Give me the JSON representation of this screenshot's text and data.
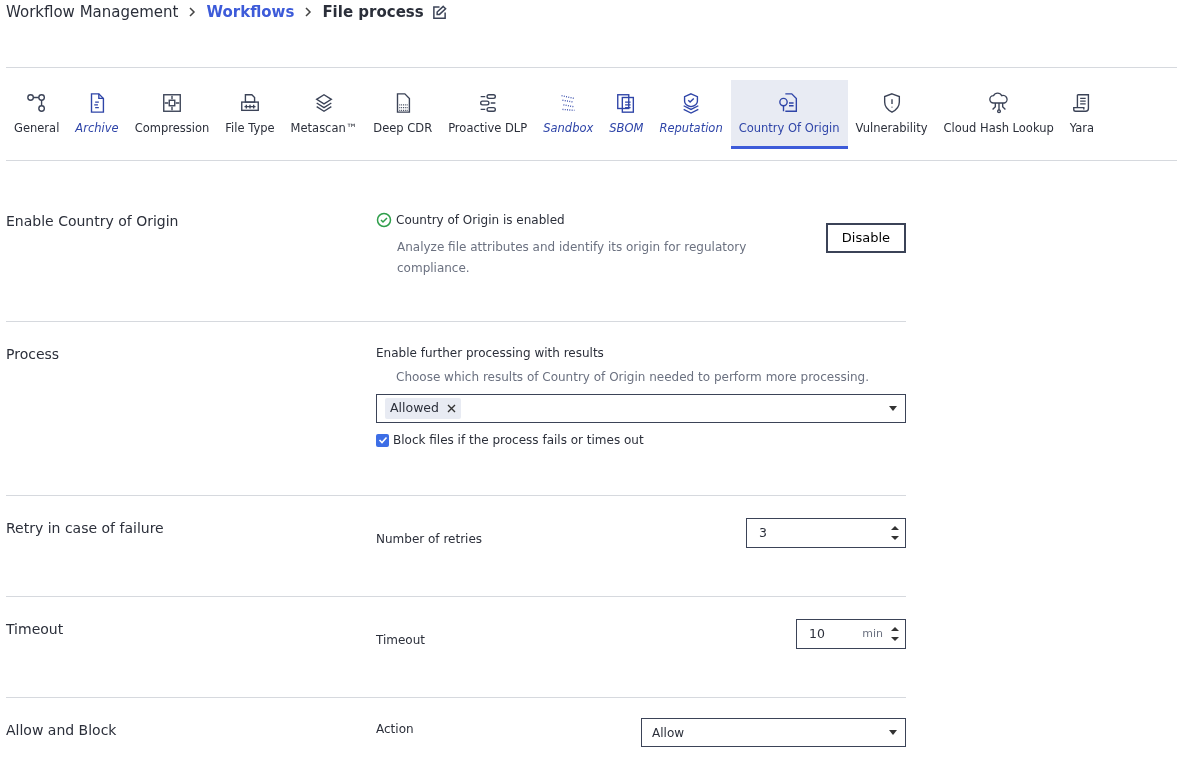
{
  "breadcrumb": [
    {
      "label": "Workflow Management",
      "kind": "plain"
    },
    {
      "label": "Workflows",
      "kind": "link"
    },
    {
      "label": "File process",
      "kind": "current"
    }
  ],
  "tabs": [
    {
      "label": "General",
      "emphasized": false,
      "selected": false
    },
    {
      "label": "Archive",
      "emphasized": true,
      "selected": false
    },
    {
      "label": "Compression",
      "emphasized": false,
      "selected": false
    },
    {
      "label": "File Type",
      "emphasized": false,
      "selected": false
    },
    {
      "label": "Metascan™",
      "emphasized": false,
      "selected": false
    },
    {
      "label": "Deep CDR",
      "emphasized": false,
      "selected": false
    },
    {
      "label": "Proactive DLP",
      "emphasized": false,
      "selected": false
    },
    {
      "label": "Sandbox",
      "emphasized": true,
      "selected": false
    },
    {
      "label": "SBOM",
      "emphasized": true,
      "selected": false
    },
    {
      "label": "Reputation",
      "emphasized": true,
      "selected": false
    },
    {
      "label": "Country Of Origin",
      "emphasized": false,
      "selected": true
    },
    {
      "label": "Vulnerability",
      "emphasized": false,
      "selected": false
    },
    {
      "label": "Cloud Hash Lookup",
      "emphasized": false,
      "selected": false
    },
    {
      "label": "Yara",
      "emphasized": false,
      "selected": false
    }
  ],
  "sections": [
    {
      "title": "Enable Country of Origin",
      "kind": "status",
      "status": "Country of Origin is enabled",
      "enabled": true,
      "description": "Analyze file attributes and identify its origin for regulatory compliance.",
      "button": "Disable"
    },
    {
      "title": "Process",
      "kind": "multiselect",
      "label": "Enable further processing with results",
      "hint": "Choose which results of Country of Origin needed to perform more processing.",
      "tags": [
        "Allowed"
      ],
      "checkbox": {
        "label": "Block files if the process fails or times out",
        "checked": true
      }
    },
    {
      "title": "Retry in case of failure",
      "kind": "number",
      "label": "Number of retries",
      "value": "3"
    },
    {
      "title": "Timeout",
      "kind": "number",
      "label": "Timeout",
      "value": "10",
      "unit": "min"
    },
    {
      "title": "Allow and Block",
      "kind": "select",
      "label": "Action",
      "value": "Allow"
    }
  ]
}
